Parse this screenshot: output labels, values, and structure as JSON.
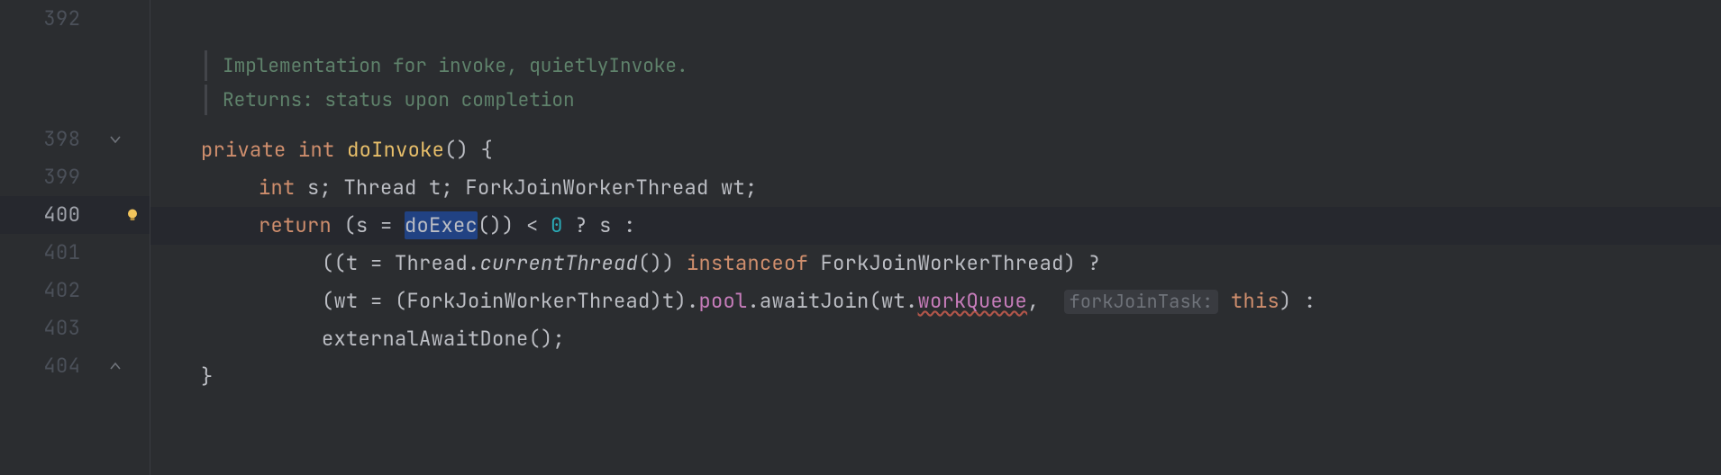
{
  "gutter": {
    "lines": [
      "392",
      "398",
      "399",
      "400",
      "401",
      "402",
      "403",
      "404"
    ]
  },
  "doc": {
    "line1": "Implementation for invoke, quietlyInvoke.",
    "line2": "Returns: status upon completion"
  },
  "code": {
    "l398": {
      "kw_private": "private",
      "kw_int": "int",
      "method": "doInvoke",
      "tail": "() {"
    },
    "l399": {
      "kw_int": "int",
      "s": " s; Thread t; ForkJoinWorkerThread wt;"
    },
    "l400": {
      "kw_return": "return",
      "pre": " (s = ",
      "doExec": "doExec",
      "mid": "()) < ",
      "zero": "0",
      "tail": " ? s :"
    },
    "l401": {
      "pre": "((t = Thread.",
      "ct": "currentThread",
      "mid": "()) ",
      "instanceof": "instanceof",
      "tail": " ForkJoinWorkerThread) ?"
    },
    "l402": {
      "pre": "(wt = (ForkJoinWorkerThread)t).",
      "pool": "pool",
      "mid1": ".awaitJoin(wt.",
      "wq": "workQueue",
      "mid2": ",  ",
      "hint": "forkJoinTask:",
      "sp": " ",
      "this": "this",
      "tail": ") :"
    },
    "l403": {
      "text": "externalAwaitDone();"
    },
    "l404": {
      "text": "}"
    }
  },
  "icons": {
    "fold_collapse": "fold-collapse-icon",
    "fold_expand": "fold-expand-icon",
    "bulb": "lightbulb-icon"
  }
}
